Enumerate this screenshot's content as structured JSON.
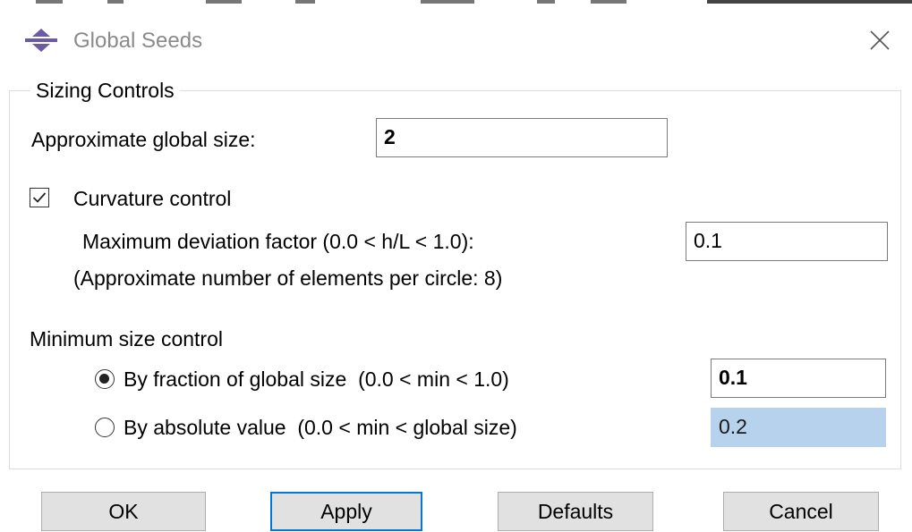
{
  "window": {
    "title": "Global Seeds",
    "icon": "abaqus-seed-icon",
    "close_icon": "close-icon"
  },
  "sizing_controls": {
    "group_title": "Sizing Controls",
    "global_size_label": "Approximate global size:",
    "global_size_value": "2",
    "curvature_control": {
      "label": "Curvature control",
      "checked": true,
      "deviation_label": "Maximum deviation factor (0.0 < h/L < 1.0):",
      "deviation_value": "0.1",
      "elements_note": "(Approximate number of elements per circle: 8)"
    },
    "minimum_size_control": {
      "label": "Minimum size control",
      "options": [
        {
          "label": "By fraction of global size  (0.0 < min < 1.0)",
          "value": "0.1",
          "selected": true
        },
        {
          "label": "By absolute value  (0.0 < min < global size)",
          "value": "0.2",
          "selected": false
        }
      ]
    }
  },
  "buttons": {
    "ok": "OK",
    "apply": "Apply",
    "defaults": "Defaults",
    "cancel": "Cancel"
  },
  "colors": {
    "disabled_field": "#b7d2ec",
    "default_button_border": "#0078d7",
    "button_face": "#e1e1e1",
    "icon_purple": "#6a5aa8"
  }
}
